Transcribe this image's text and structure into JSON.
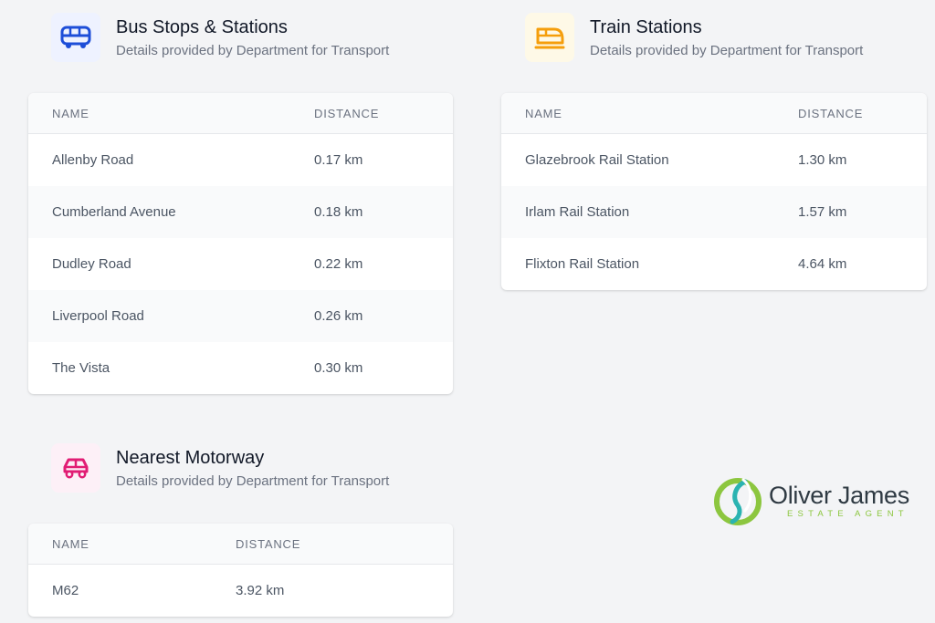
{
  "bus": {
    "title": "Bus Stops & Stations",
    "subtitle": "Details provided by Department for Transport",
    "icon": "bus-icon",
    "icon_color": "#1d4ed8",
    "icon_bg": "#eef2ff",
    "headers": {
      "name": "NAME",
      "distance": "DISTANCE"
    },
    "rows": [
      {
        "name": "Allenby Road",
        "distance": "0.17 km"
      },
      {
        "name": "Cumberland Avenue",
        "distance": "0.18 km"
      },
      {
        "name": "Dudley Road",
        "distance": "0.22 km"
      },
      {
        "name": "Liverpool Road",
        "distance": "0.26 km"
      },
      {
        "name": "The Vista",
        "distance": "0.30 km"
      }
    ]
  },
  "train": {
    "title": "Train Stations",
    "subtitle": "Details provided by Department for Transport",
    "icon": "train-icon",
    "icon_color": "#f59e0b",
    "icon_bg": "#fef9e7",
    "headers": {
      "name": "NAME",
      "distance": "DISTANCE"
    },
    "rows": [
      {
        "name": "Glazebrook Rail Station",
        "distance": "1.30 km"
      },
      {
        "name": "Irlam Rail Station",
        "distance": "1.57 km"
      },
      {
        "name": "Flixton Rail Station",
        "distance": "4.64 km"
      }
    ]
  },
  "motorway": {
    "title": "Nearest Motorway",
    "subtitle": "Details provided by Department for Transport",
    "icon": "car-icon",
    "icon_color": "#e11d74",
    "icon_bg": "#fdf0f7",
    "headers": {
      "name": "NAME",
      "distance": "DISTANCE"
    },
    "rows": [
      {
        "name": "M62",
        "distance": "3.92 km"
      }
    ]
  },
  "logo": {
    "name": "Oliver James",
    "tagline": "ESTATE AGENT",
    "green": "#8cc63f",
    "teal": "#2bb3b1"
  }
}
